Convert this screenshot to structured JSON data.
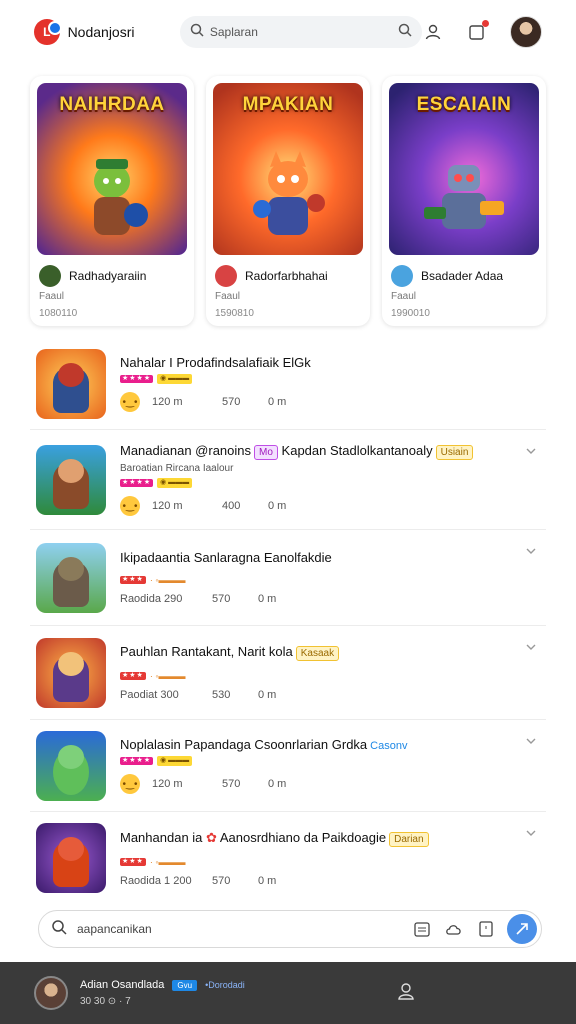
{
  "header": {
    "logo_text": "L",
    "app_name": "Nodanjosri",
    "search_placeholder": "Saplaran"
  },
  "featured": [
    {
      "art_title": "NAIHRDAA",
      "name": "Radhadyaraiin",
      "sub": "Faaul",
      "stat": "1080110"
    },
    {
      "art_title": "MPAKIAN",
      "name": "Radorfarbhahai",
      "sub": "Faaul",
      "stat": "1590810"
    },
    {
      "art_title": "ESCAIAIN",
      "name": "Bsadader Adaa",
      "sub": "Faaul",
      "stat": "1990010"
    }
  ],
  "list": [
    {
      "title": "Nahalar I Prodafindsalafiaik ElGk",
      "tag1": "",
      "tag2": "",
      "desc": "",
      "emoji": "•‿•",
      "s1": "120 m",
      "s2": "570",
      "s3": "0 m"
    },
    {
      "title": "Manadianan @ranoins",
      "tag1": "Mo",
      "tag2": "Kapdan Stadlolkantanoaly",
      "tag3": "Usiain",
      "desc": "Baroatian Rircana Iaalour",
      "emoji": "•‿•",
      "s1": "120 m",
      "s2": "400",
      "s3": "0 m"
    },
    {
      "title": "Ikipadaantia Sanlaragna Eanolfakdie",
      "tag1": "",
      "tag2": "",
      "desc": "",
      "s1": "Raodida 290",
      "s2": "570",
      "s3": "0 m"
    },
    {
      "title": "Pauhlan Rantakant, Narit kola",
      "tag3": "Kasaak",
      "desc": "",
      "s1": "Paodiat 300",
      "s2": "530",
      "s3": "0 m"
    },
    {
      "title": "Noplalasin Papandaga Csoonrlarian Grdka",
      "tag_blue": "Casonv",
      "desc": "",
      "emoji": "•‿•",
      "s1": "120 m",
      "s2": "570",
      "s3": "0 m"
    },
    {
      "title": "Manhandan ia",
      "tag2": "Aanosrdhiano da Paikdoagie",
      "tag3": "Darian",
      "desc": "",
      "s1": "Raodida 1 200",
      "s2": "570",
      "s3": "0 m"
    }
  ],
  "bottom_search": {
    "placeholder": "aapancanikan"
  },
  "footer": {
    "user_name": "Adian Osandlada",
    "badge": "Gvu",
    "handle": "•Dorodadi",
    "meta": "30 30 ⊙ · 7"
  },
  "icons": {
    "logo": "app-logo-icon",
    "search": "search-icon",
    "profile": "profile-icon",
    "notification": "notification-icon",
    "chevron": "chevron-down-icon",
    "calendar": "calendar-icon",
    "cloud": "cloud-icon",
    "note": "note-icon",
    "send": "send-icon"
  },
  "colors": {
    "accent": "#4a8fe8",
    "logo": "#e4322b",
    "footer_bg": "#3a3a3a",
    "tag_pink": "#c04ee6",
    "tag_yellow": "#f1c232"
  }
}
